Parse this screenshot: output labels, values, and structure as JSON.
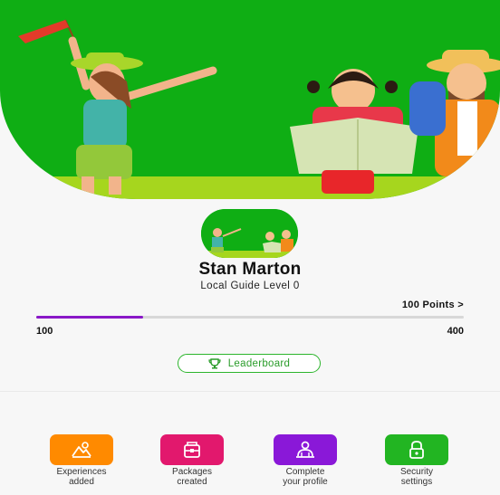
{
  "profile": {
    "name": "Stan Marton",
    "level": "Local Guide Level 0"
  },
  "points": {
    "link_label": "100 Points >",
    "min_label": "100",
    "max_label": "400",
    "progress_percent": 25
  },
  "leaderboard": {
    "label": "Leaderboard"
  },
  "actions": [
    {
      "label": "Experiences\nadded",
      "icon": "mountain-sun-icon",
      "color": "#ff8a00"
    },
    {
      "label": "Packages\ncreated",
      "icon": "package-icon",
      "color": "#e2186d"
    },
    {
      "label": "Complete\nyour profile",
      "icon": "profile-icon",
      "color": "#8a18d8"
    },
    {
      "label": "Security\nsettings",
      "icon": "lock-icon",
      "color": "#22b522"
    }
  ],
  "colors": {
    "hero_green": "#0fae14",
    "progress": "#8a18c8",
    "accent_green": "#2cb52c"
  }
}
